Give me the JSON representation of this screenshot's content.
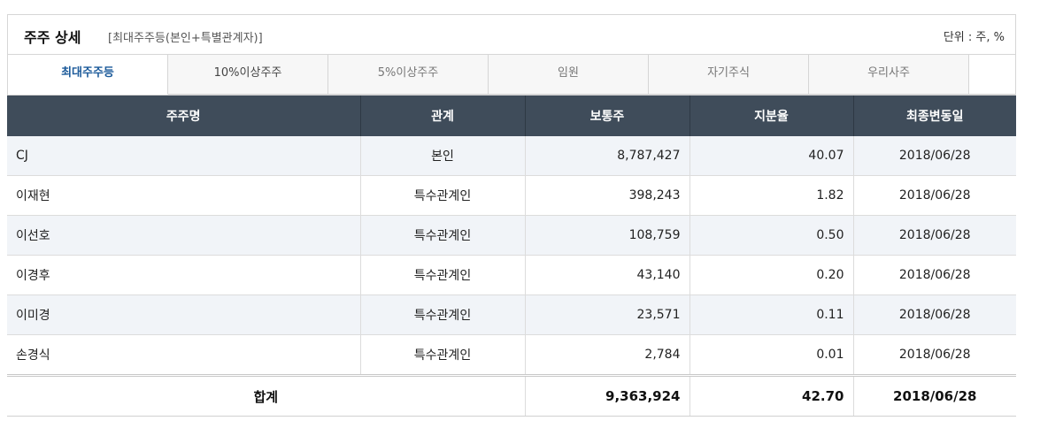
{
  "header": {
    "title": "주주 상세",
    "subtitle": "[최대주주등(본인+특별관계자)]",
    "unit": "단위 : 주, %"
  },
  "tabs": [
    {
      "label": "최대주주등",
      "active": true
    },
    {
      "label": "10%이상주주",
      "active": false
    },
    {
      "label": "5%이상주주",
      "active": false
    },
    {
      "label": "임원",
      "active": false
    },
    {
      "label": "자기주식",
      "active": false
    },
    {
      "label": "우리사주",
      "active": false
    }
  ],
  "table": {
    "columns": [
      "주주명",
      "관계",
      "보통주",
      "지분율",
      "최종변동일"
    ],
    "rows": [
      {
        "name": "CJ",
        "relation": "본인",
        "shares": "8,787,427",
        "ratio": "40.07",
        "date": "2018/06/28"
      },
      {
        "name": "이재현",
        "relation": "특수관계인",
        "shares": "398,243",
        "ratio": "1.82",
        "date": "2018/06/28"
      },
      {
        "name": "이선호",
        "relation": "특수관계인",
        "shares": "108,759",
        "ratio": "0.50",
        "date": "2018/06/28"
      },
      {
        "name": "이경후",
        "relation": "특수관계인",
        "shares": "43,140",
        "ratio": "0.20",
        "date": "2018/06/28"
      },
      {
        "name": "이미경",
        "relation": "특수관계인",
        "shares": "23,571",
        "ratio": "0.11",
        "date": "2018/06/28"
      },
      {
        "name": "손경식",
        "relation": "특수관계인",
        "shares": "2,784",
        "ratio": "0.01",
        "date": "2018/06/28"
      }
    ],
    "total": {
      "label": "합계",
      "shares": "9,363,924",
      "ratio": "42.70",
      "date": "2018/06/28"
    }
  },
  "colors": {
    "header_bg": "#3f4c5a",
    "active_tab_text": "#1b5a9a",
    "shaded_row": "#f1f4f8"
  }
}
